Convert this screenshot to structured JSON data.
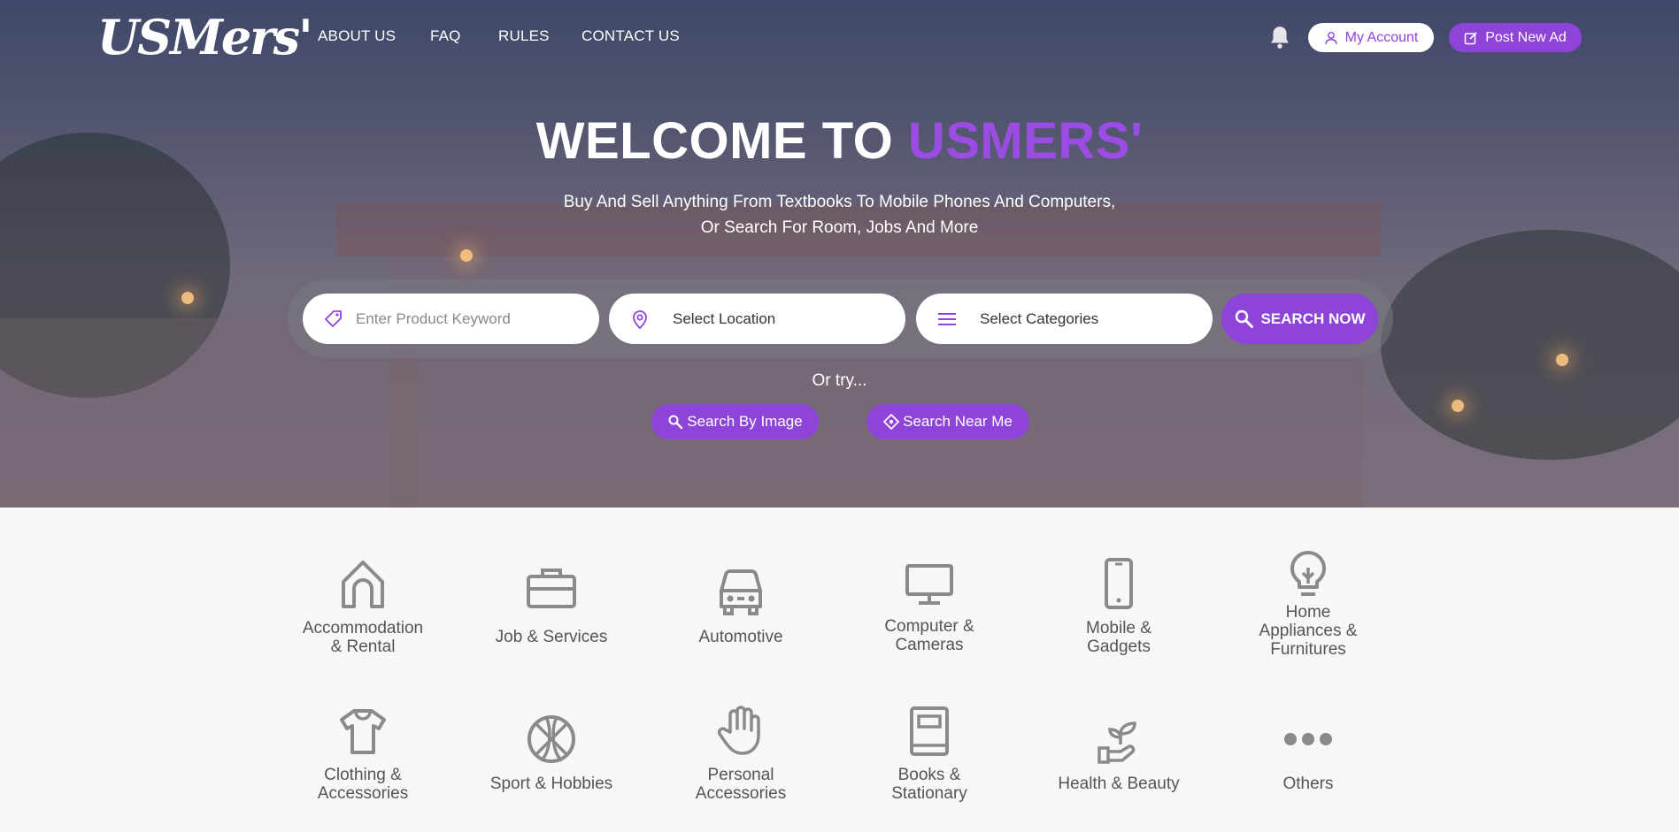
{
  "logo": {
    "text": "USMers'"
  },
  "nav": {
    "links": [
      "ABOUT US",
      "FAQ",
      "RULES",
      "CONTACT US"
    ],
    "account_label": "My Account",
    "post_label": "Post New Ad"
  },
  "hero": {
    "title_part1": "WELCOME TO ",
    "title_part2": "USMERS'",
    "subtitle_line1": "Buy And Sell Anything From Textbooks To Mobile Phones And Computers,",
    "subtitle_line2": "Or Search For Room, Jobs And More"
  },
  "search": {
    "keyword_placeholder": "Enter Product Keyword",
    "location_label": "Select Location",
    "category_label": "Select Categories",
    "button_label": "SEARCH NOW",
    "or_try": "Or try...",
    "by_image_label": "Search By Image",
    "near_me_label": "Search Near Me"
  },
  "categories": [
    {
      "line1": "Accommodation",
      "line2": "& Rental",
      "line3": "",
      "icon": "house-icon"
    },
    {
      "line1": "Job & Services",
      "line2": "",
      "line3": "",
      "icon": "briefcase-icon"
    },
    {
      "line1": "Automotive",
      "line2": "",
      "line3": "",
      "icon": "car-icon"
    },
    {
      "line1": "Computer &",
      "line2": "Cameras",
      "line3": "",
      "icon": "monitor-icon"
    },
    {
      "line1": "Mobile &",
      "line2": "Gadgets",
      "line3": "",
      "icon": "phone-icon"
    },
    {
      "line1": "Home",
      "line2": "Appliances &",
      "line3": "Furnitures",
      "icon": "lightbulb-icon"
    },
    {
      "line1": "Clothing &",
      "line2": "Accessories",
      "line3": "",
      "icon": "shirt-icon"
    },
    {
      "line1": "Sport & Hobbies",
      "line2": "",
      "line3": "",
      "icon": "basketball-icon"
    },
    {
      "line1": "Personal",
      "line2": "Accessories",
      "line3": "",
      "icon": "hand-icon"
    },
    {
      "line1": "Books &",
      "line2": "Stationary",
      "line3": "",
      "icon": "book-icon"
    },
    {
      "line1": "Health & Beauty",
      "line2": "",
      "line3": "",
      "icon": "plant-hand-icon"
    },
    {
      "line1": "Others",
      "line2": "",
      "line3": "",
      "icon": "more-dots-icon"
    }
  ],
  "colors": {
    "accent": "#8e44d9",
    "icon_gray": "#8a8a8a"
  }
}
